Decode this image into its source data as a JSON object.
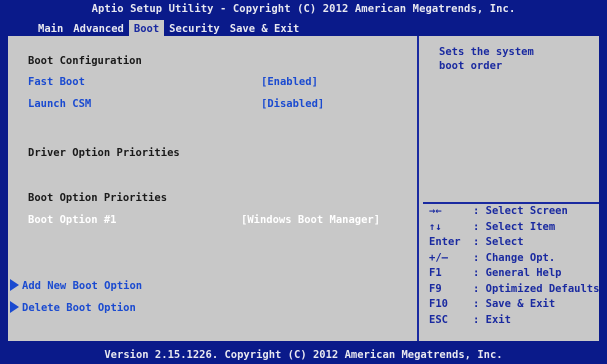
{
  "title": "Aptio Setup Utility - Copyright (C) 2012 American Megatrends, Inc.",
  "menu": [
    "Main",
    "Advanced",
    "Boot",
    "Security",
    "Save & Exit"
  ],
  "active_menu": "Boot",
  "left_panel": {
    "boot_configuration": "Boot Configuration",
    "fast_boot": {
      "label": "Fast Boot",
      "value": "[Enabled]"
    },
    "launch_csm": {
      "label": "Launch CSM",
      "value": "[Disabled]"
    },
    "driver_option_priorities": "Driver Option Priorities",
    "boot_option_priorities": "Boot Option Priorities",
    "boot_option_1": {
      "label": "Boot Option #1",
      "value": "[Windows Boot Manager]"
    },
    "add_new_boot_option": "Add New Boot Option",
    "delete_boot_option": "Delete Boot Option"
  },
  "help_text": "Sets the system\nboot order",
  "keys": [
    {
      "key": "→←",
      "desc": ": Select Screen"
    },
    {
      "key": "↑↓",
      "desc": ": Select Item"
    },
    {
      "key": "Enter",
      "desc": ": Select"
    },
    {
      "key": "+/—",
      "desc": ": Change Opt."
    },
    {
      "key": "F1",
      "desc": ": General Help"
    },
    {
      "key": "F9",
      "desc": ": Optimized Defaults"
    },
    {
      "key": "F10",
      "desc": ": Save & Exit"
    },
    {
      "key": "ESC",
      "desc": ": Exit"
    }
  ],
  "footer": "Version 2.15.1226. Copyright (C) 2012 American Megatrends, Inc.",
  "colors": {
    "background": "#0a1a8a",
    "panel": "#c8c8c8",
    "link": "#1a4ad0",
    "selected": "#ffffff"
  }
}
